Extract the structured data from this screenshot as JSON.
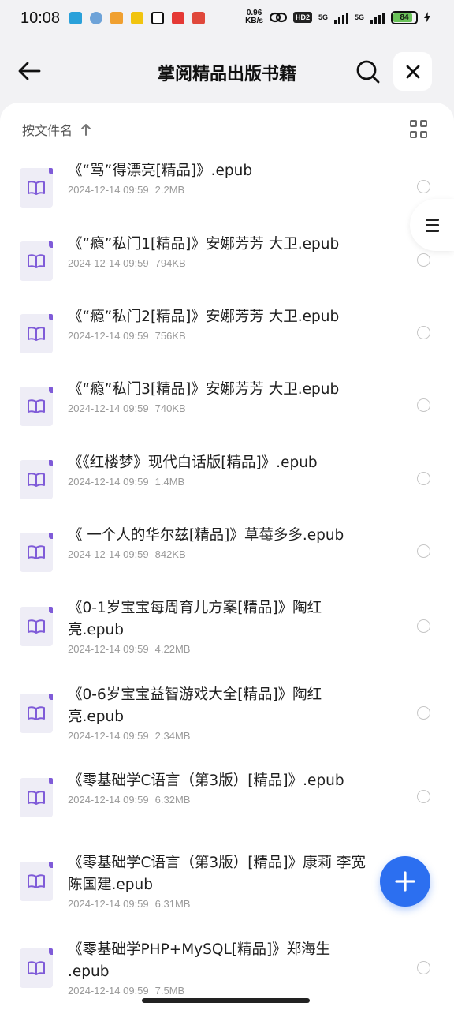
{
  "status_bar": {
    "time": "10:08",
    "net_speed_value": "0.96",
    "net_speed_unit": "KB/s",
    "hd_label": "HD2",
    "signal1_label": "5G",
    "signal2_label": "5G",
    "battery_level": "84",
    "notification_icons": [
      {
        "name": "telegram-icon",
        "color": "#2aa1da"
      },
      {
        "name": "clover-icon",
        "color": "#6ea3d8"
      },
      {
        "name": "flower-app-icon",
        "color": "#f0a030"
      },
      {
        "name": "news-app-icon",
        "color": "#f1c40f"
      },
      {
        "name": "v-app-icon",
        "color": "#111111"
      },
      {
        "name": "tiktok-icon",
        "color": "#e53935"
      },
      {
        "name": "red-app-icon",
        "color": "#e0483b"
      }
    ]
  },
  "header": {
    "title": "掌阅精品出版书籍"
  },
  "toolbar": {
    "sort_label": "按文件名"
  },
  "files": [
    {
      "name": "《“骂”得漂亮[精品]》.epub",
      "date": "2024-12-14 09:59",
      "size": "2.2MB"
    },
    {
      "name": "《“瘾”私门1[精品]》安娜芳芳 大卫.epub",
      "date": "2024-12-14 09:59",
      "size": "794KB"
    },
    {
      "name": "《“瘾”私门2[精品]》安娜芳芳 大卫.epub",
      "date": "2024-12-14 09:59",
      "size": "756KB"
    },
    {
      "name": "《“瘾”私门3[精品]》安娜芳芳 大卫.epub",
      "date": "2024-12-14 09:59",
      "size": "740KB"
    },
    {
      "name": "《《红楼梦》现代白话版[精品]》.epub",
      "date": "2024-12-14 09:59",
      "size": "1.4MB"
    },
    {
      "name": "《 一个人的华尔兹[精品]》草莓多多.epub",
      "date": "2024-12-14 09:59",
      "size": "842KB"
    },
    {
      "name": "《0-1岁宝宝每周育儿方案[精品]》陶红亮.epub",
      "date": "2024-12-14 09:59",
      "size": "4.22MB"
    },
    {
      "name": "《0-6岁宝宝益智游戏大全[精品]》陶红亮.epub",
      "date": "2024-12-14 09:59",
      "size": "2.34MB"
    },
    {
      "name": "《零基础学C语言（第3版）[精品]》.epub",
      "date": "2024-12-14 09:59",
      "size": "6.32MB"
    },
    {
      "name": "《零基础学C语言（第3版）[精品]》康莉 李宽 陈国建.epub",
      "date": "2024-12-14 09:59",
      "size": "6.31MB"
    },
    {
      "name": "《零基础学PHP+MySQL[精品]》郑海生 .epub",
      "date": "2024-12-14 09:59",
      "size": "7.5MB"
    }
  ],
  "colors": {
    "accent": "#2c6ff0",
    "file_badge": "#7f5bd8",
    "battery": "#6ac259"
  }
}
